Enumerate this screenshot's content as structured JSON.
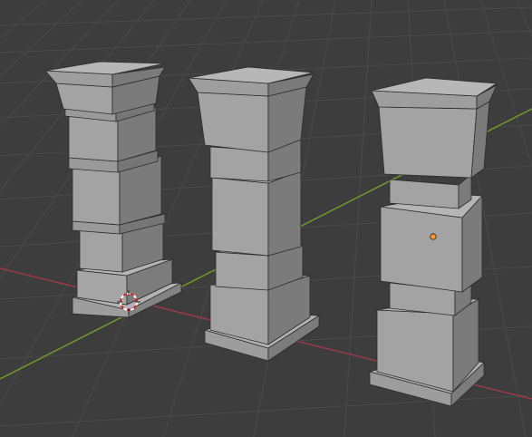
{
  "viewport": {
    "colors": {
      "background": "#3d3d3d",
      "grid_line": "#4a4a4a",
      "x_axis": "#9a3b46",
      "y_axis": "#6f9a2b",
      "mesh_light": "#b2b2b2",
      "mesh_mid": "#9d9d9d",
      "mesh_dark": "#838383",
      "mesh_shadow": "#747474",
      "mesh_edge": "#2c2c2c",
      "origin_dot": "#ff9a2a",
      "cursor_red": "#d0212a",
      "cursor_white": "#ffffff"
    },
    "objects": [
      "pillar-1",
      "pillar-2",
      "pillar-3"
    ],
    "icons": {
      "cursor": "3d-cursor-icon",
      "origin": "object-origin-icon"
    }
  }
}
